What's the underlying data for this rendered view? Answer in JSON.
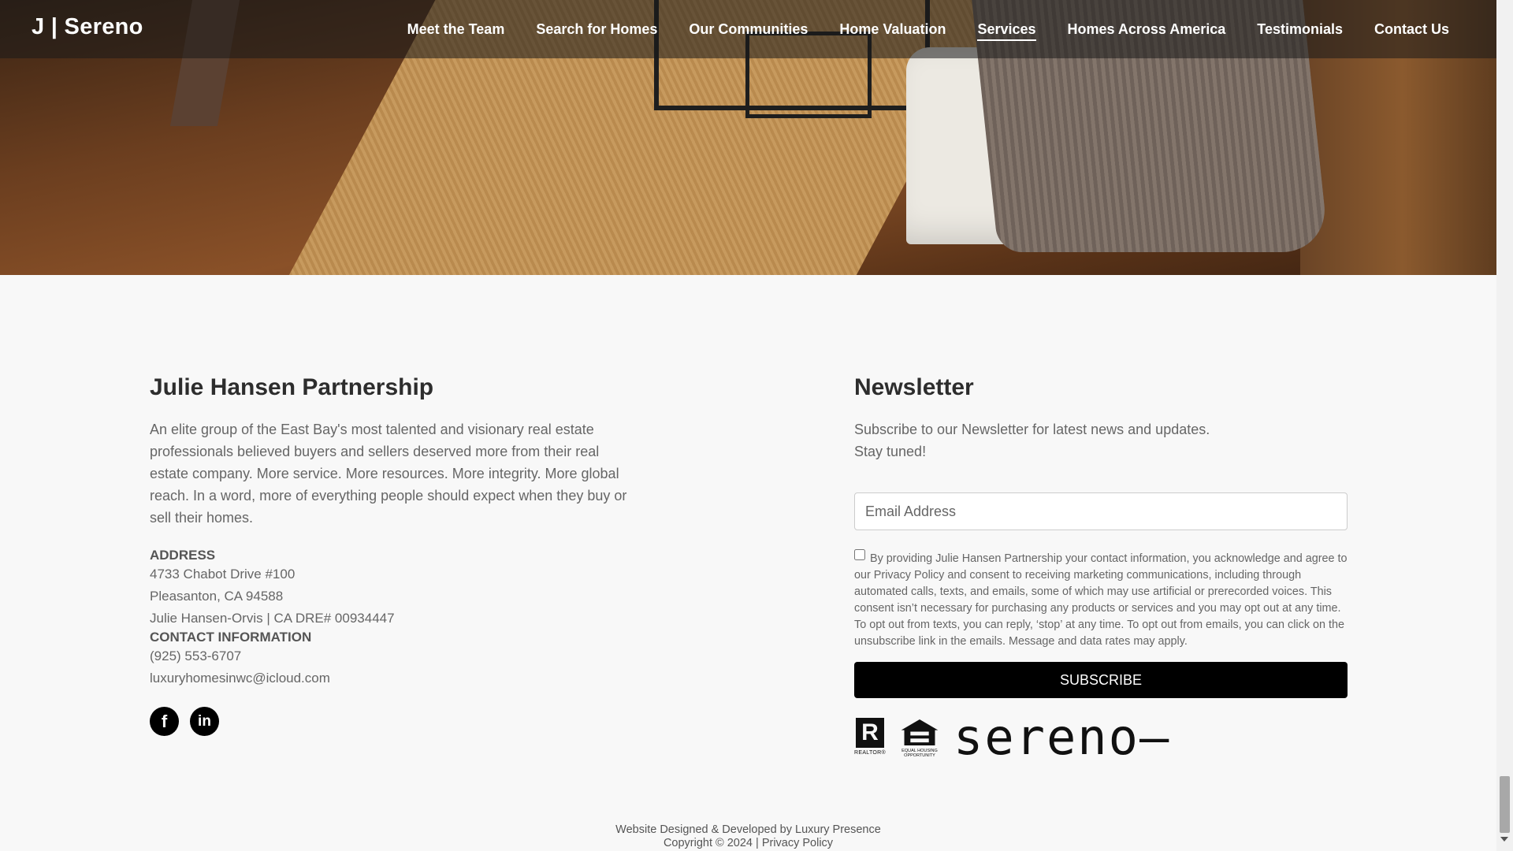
{
  "brand": {
    "logo": "J | Sereno"
  },
  "nav": {
    "items": [
      {
        "label": "Meet the Team"
      },
      {
        "label": "Search for Homes"
      },
      {
        "label": "Our Communities"
      },
      {
        "label": "Home Valuation"
      },
      {
        "label": "Services",
        "active": true
      },
      {
        "label": "Homes Across America"
      },
      {
        "label": "Testimonials"
      },
      {
        "label": "Contact Us"
      }
    ]
  },
  "about": {
    "title": "Julie Hansen Partnership",
    "description": "An elite group of the East Bay's most talented and visionary real estate professionals believed buyers and sellers deserved more from their real estate company. More service. More resources. More integrity. More global reach. In a word, more of everything people should expect when they buy or sell their homes.",
    "address_label": "ADDRESS",
    "address_line1": "4733 Chabot Drive #100",
    "address_line2": "Pleasanton, CA 94588",
    "license": "Julie Hansen-Orvis | CA DRE# 00934447",
    "contact_label": "CONTACT INFORMATION",
    "phone": "(925) 553-6707",
    "email": "luxuryhomesinwc@icloud.com",
    "social": {
      "facebook": "f",
      "linkedin": "in"
    }
  },
  "newsletter": {
    "title": "Newsletter",
    "subtitle_line1": "Subscribe to our Newsletter for latest news and updates.",
    "subtitle_line2": "Stay tuned!",
    "email_placeholder": "Email Address",
    "consent": "By providing Julie Hansen Partnership your contact information, you acknowledge and agree to our Privacy Policy and consent to receiving marketing communications, including through automated calls, texts, and emails, some of which may use artificial or prerecorded voices. This consent isn’t necessary for purchasing any products or services and you may opt out at any time. To opt out from texts, you can reply, ‘stop’ at any time. To opt out from emails, you can click on the unsubscribe link in the emails. Message and data rates may apply.",
    "subscribe_label": "SUBSCRIBE",
    "consent_checked": false
  },
  "logos": {
    "realtor_mark": "R",
    "realtor_text": "REALTOR®",
    "eho_text": "EQUAL HOUSING OPPORTUNITY",
    "sereno": "sereno—"
  },
  "credits": {
    "line1": "Website Designed & Developed by Luxury Presence",
    "line2": "Copyright © 2024 | Privacy Policy"
  }
}
